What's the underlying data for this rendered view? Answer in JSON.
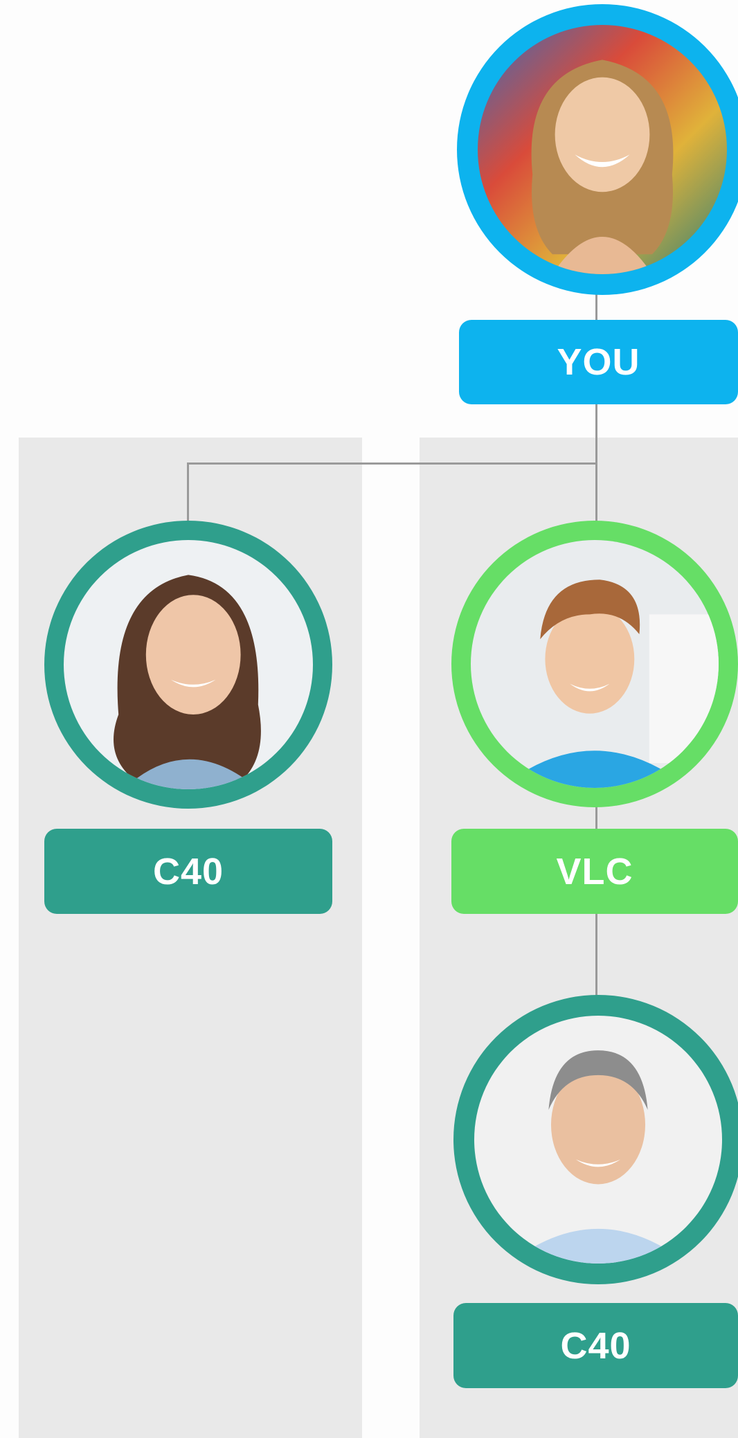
{
  "colors": {
    "you": "#0db3ee",
    "vlc": "#66de66",
    "c40": "#2f9f8c",
    "column_bg": "#e9e9e9",
    "connector": "#9a9a9a"
  },
  "nodes": {
    "you": {
      "label": "YOU",
      "icon": "avatar-woman-smiling"
    },
    "left": {
      "label": "C40",
      "icon": "avatar-woman-brown-hair"
    },
    "mid": {
      "label": "VLC",
      "icon": "avatar-young-man-blue-shirt"
    },
    "bottom": {
      "label": "C40",
      "icon": "avatar-older-man-gray-hair"
    }
  }
}
